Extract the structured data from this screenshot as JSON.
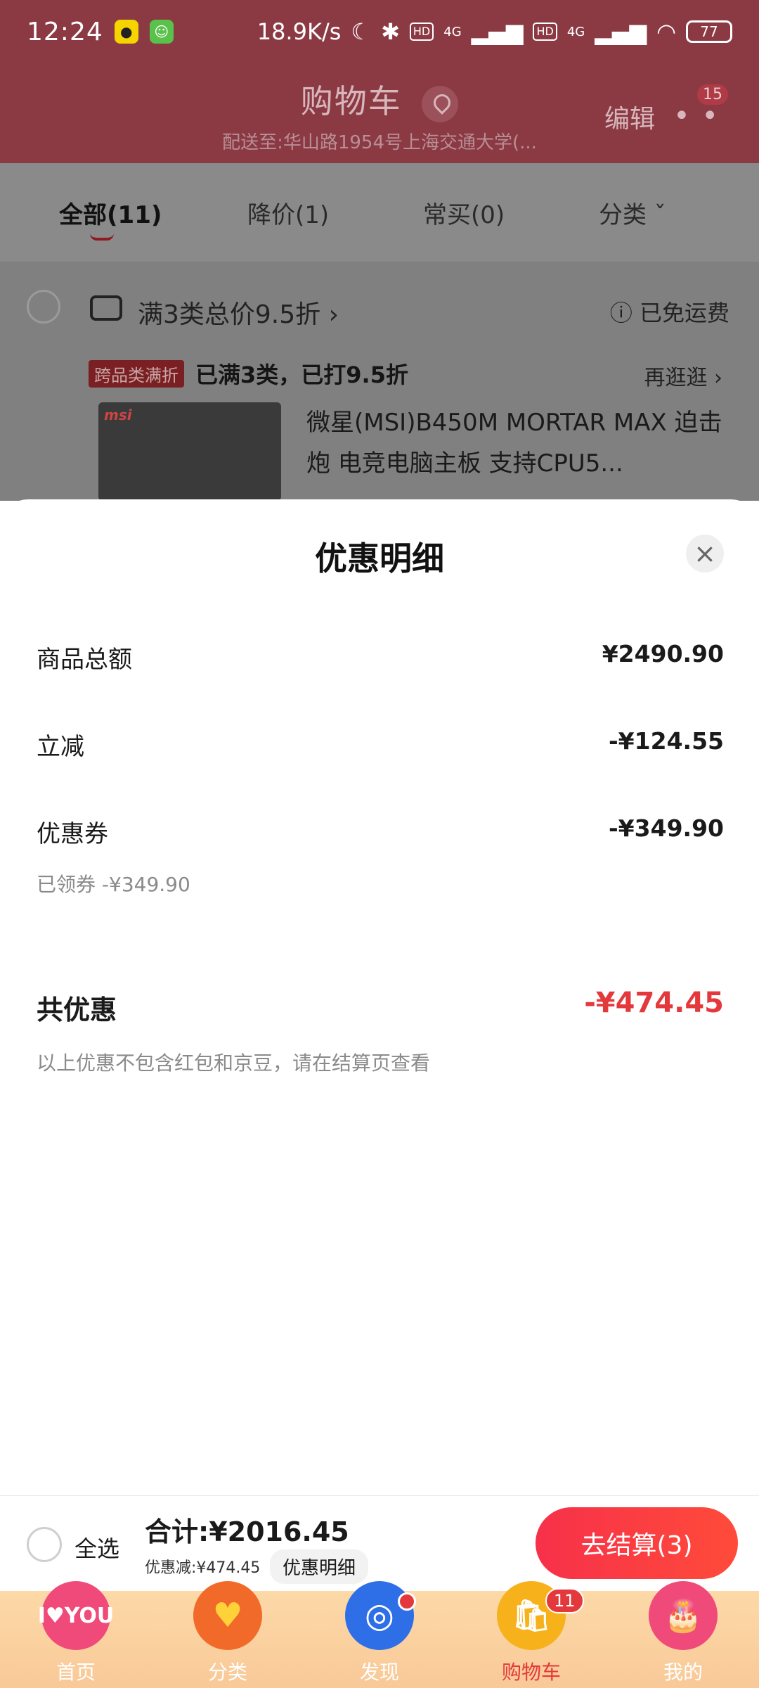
{
  "status_bar": {
    "time": "12:24",
    "speed": "18.9K/s",
    "signal_4g_1": "4G",
    "signal_4g_2": "4G",
    "hd_1": "HD",
    "hd_2": "HD",
    "battery": "77"
  },
  "header": {
    "title": "购物车",
    "address": "配送至:华山路1954号上海交通大学(...",
    "edit_label": "编辑",
    "more_badge": "15"
  },
  "tabs": [
    {
      "label": "全部(11)",
      "active": true
    },
    {
      "label": "降价(1)",
      "active": false
    },
    {
      "label": "常买(0)",
      "active": false
    },
    {
      "label": "分类 ˇ",
      "active": false
    }
  ],
  "store": {
    "promo_title": "满3类总价9.5折 ›",
    "free_shipping": "ⓘ 已免运费",
    "tag": "跨品类满折",
    "tag_text": "已满3类，已打9.5折",
    "browse": "再逛逛 ›",
    "product_logo": "msi",
    "product_title": "微星(MSI)B450M MORTAR MAX 迫击炮 电竞电脑主板 支持CPU5..."
  },
  "sheet": {
    "title": "优惠明细",
    "close_icon": "×",
    "rows": [
      {
        "label": "商品总额",
        "value": "¥2490.90"
      },
      {
        "label": "立减",
        "value": "-¥124.55"
      },
      {
        "label": "优惠券",
        "value": "-¥349.90"
      }
    ],
    "coupon_sub": "已领券 -¥349.90",
    "total_label": "共优惠",
    "total_value": "-¥474.45",
    "note": "以上优惠不包含红包和京豆，请在结算页查看"
  },
  "action_bar": {
    "select_all": "全选",
    "sum": "合计:¥2016.45",
    "discount": "优惠减:¥474.45",
    "detail": "优惠明细",
    "checkout": "去结算(3)"
  },
  "bottom_nav": [
    {
      "label": "首页",
      "icon_text": "I♥YOU",
      "color": "#f04a7a",
      "active": false
    },
    {
      "label": "分类",
      "icon_text": "♥",
      "color": "#f26a2a",
      "active": false
    },
    {
      "label": "发现",
      "icon_text": "◎",
      "color": "#2e6fe8",
      "active": false
    },
    {
      "label": "购物车",
      "icon_text": "🛍",
      "color": "#f7b21b",
      "active": true,
      "badge": "11"
    },
    {
      "label": "我的",
      "icon_text": "🎂",
      "color": "#f04a7a",
      "active": false
    }
  ],
  "colors": {
    "accent_red": "#e4393c",
    "checkout_gradient_start": "#f7304a",
    "checkout_gradient_end": "#ff4b3a"
  }
}
